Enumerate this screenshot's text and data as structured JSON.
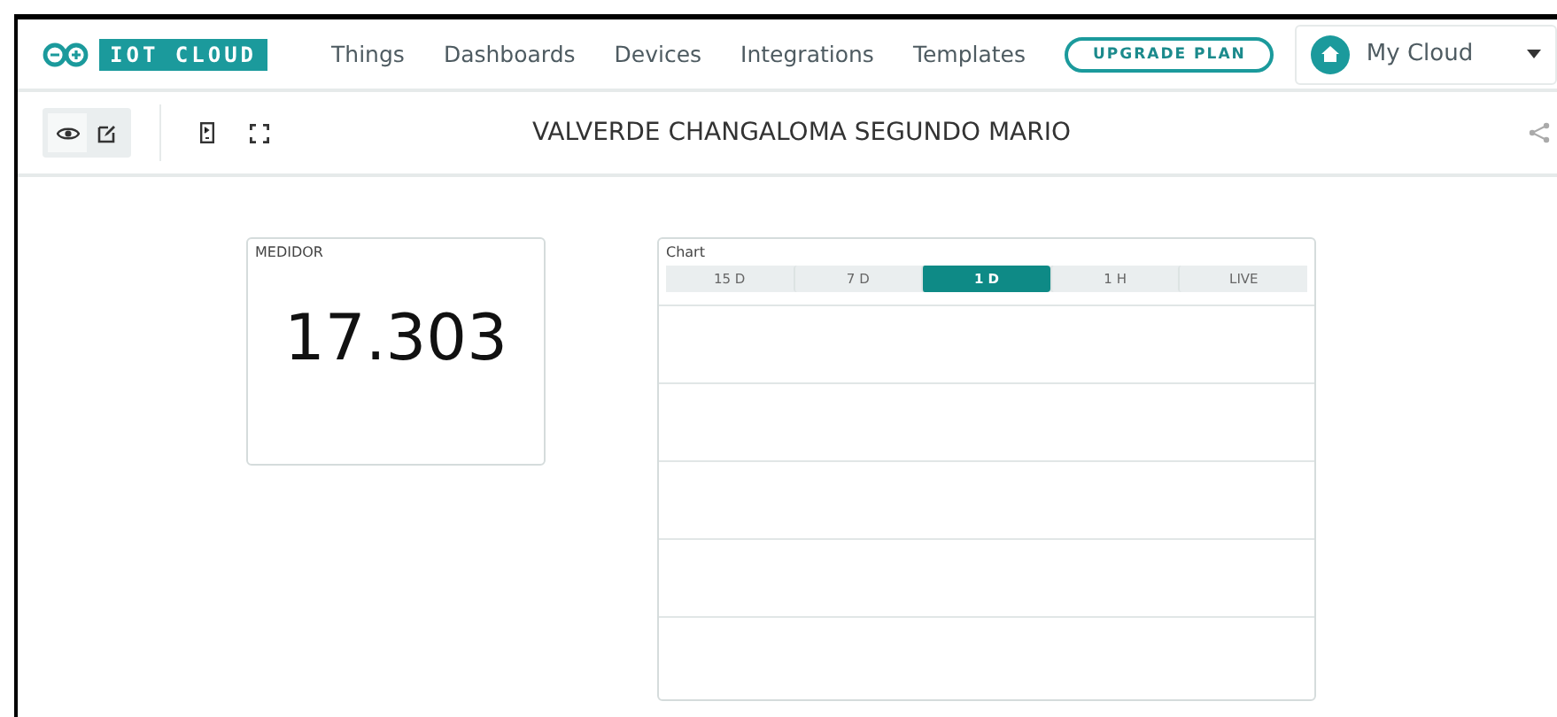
{
  "header": {
    "logo_text": "IOT CLOUD",
    "nav": [
      "Things",
      "Dashboards",
      "Devices",
      "Integrations",
      "Templates"
    ],
    "upgrade": "UPGRADE PLAN",
    "space": "My Cloud"
  },
  "toolbar": {
    "modes": [
      {
        "kind": "view",
        "selected": true
      },
      {
        "kind": "edit",
        "selected": false
      }
    ],
    "title": "VALVERDE CHANGALOMA SEGUNDO MARIO"
  },
  "widgets": {
    "value": {
      "label": "MEDIDOR",
      "value": "17.303"
    },
    "chart": {
      "label": "Chart",
      "ranges": [
        {
          "label": "15 D",
          "selected": false
        },
        {
          "label": "7 D",
          "selected": false
        },
        {
          "label": "1 D",
          "selected": true
        },
        {
          "label": "1 H",
          "selected": false
        },
        {
          "label": "LIVE",
          "selected": false
        }
      ]
    }
  }
}
